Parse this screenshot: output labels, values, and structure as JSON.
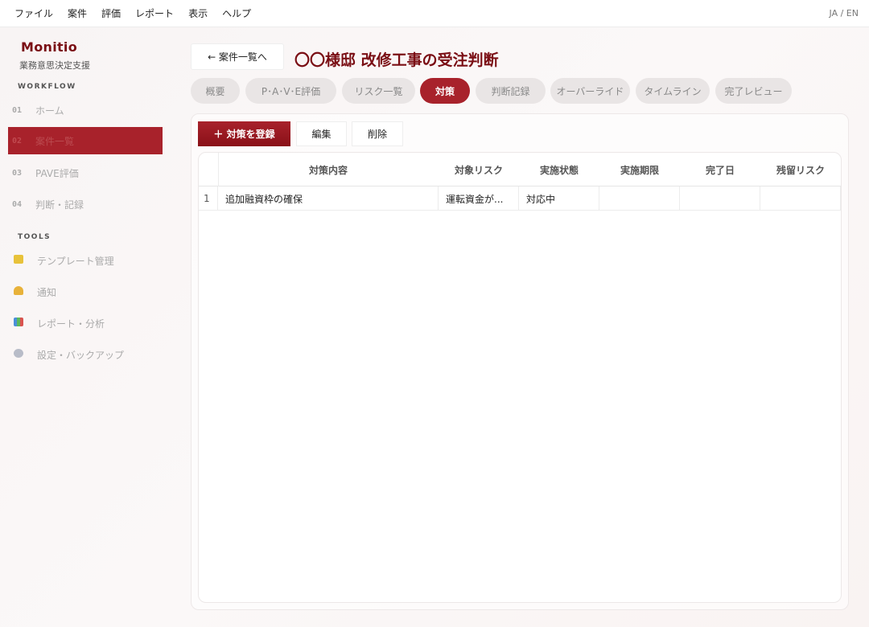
{
  "menubar": {
    "items": [
      "ファイル",
      "案件",
      "評価",
      "レポート",
      "表示",
      "ヘルプ"
    ],
    "lang": "JA / EN"
  },
  "sidebar": {
    "brand": "Monitio",
    "brand_sub": "業務意思決定支援",
    "workflow_label": "WORKFLOW",
    "workflow_items": [
      {
        "num": "01",
        "label": "ホーム"
      },
      {
        "num": "02",
        "label": "案件一覧"
      },
      {
        "num": "03",
        "label": "PAVE評価"
      },
      {
        "num": "04",
        "label": "判断・記録"
      }
    ],
    "tools_label": "TOOLS",
    "tool_items": [
      {
        "icon": "folder-icon",
        "label": "テンプレート管理"
      },
      {
        "icon": "bell-icon",
        "label": "通知"
      },
      {
        "icon": "chart-icon",
        "label": "レポート・分析"
      },
      {
        "icon": "gear-icon",
        "label": "設定・バックアップ"
      }
    ]
  },
  "header": {
    "back_label": "← 案件一覧へ",
    "title": "〇〇様邸 改修工事の受注判断"
  },
  "tabs": [
    "概要",
    "P･A･V･E評価",
    "リスク一覧",
    "対策",
    "判断記録",
    "オーバーライド",
    "タイムライン",
    "完了レビュー"
  ],
  "toolbar": {
    "add_label": "＋ 対策を登録",
    "edit_label": "編集",
    "delete_label": "削除"
  },
  "table": {
    "headers": [
      "対策内容",
      "対象リスク",
      "実施状態",
      "実施期限",
      "完了日",
      "残留リスク"
    ],
    "rows": [
      {
        "no": "1",
        "content": "追加融資枠の確保",
        "risk": "運転資金が...",
        "status": "対応中",
        "due": "",
        "done": "",
        "residual": ""
      }
    ]
  }
}
